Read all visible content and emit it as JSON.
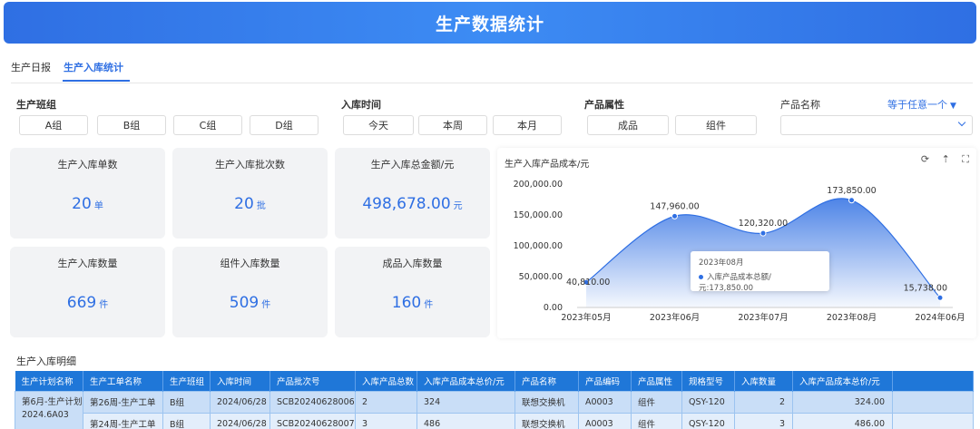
{
  "header": {
    "title": "生产数据统计"
  },
  "tabs": [
    {
      "label": "生产日报",
      "active": false
    },
    {
      "label": "生产入库统计",
      "active": true
    }
  ],
  "filters": {
    "team": {
      "label": "生产班组",
      "options": [
        "A组",
        "B组",
        "C组",
        "D组"
      ]
    },
    "time": {
      "label": "入库时间",
      "options": [
        "今天",
        "本周",
        "本月"
      ]
    },
    "attr": {
      "label": "产品属性",
      "options": [
        "成品",
        "组件"
      ]
    },
    "product_name": {
      "label": "产品名称",
      "match_mode": "等于任意一个",
      "value": ""
    }
  },
  "stats": [
    {
      "title": "生产入库单数",
      "value": "20",
      "unit": "单"
    },
    {
      "title": "生产入库批次数",
      "value": "20",
      "unit": "批"
    },
    {
      "title": "生产入库总金额/元",
      "value": "498,678.00",
      "unit": "元"
    },
    {
      "title": "生产入库数量",
      "value": "669",
      "unit": "件"
    },
    {
      "title": "组件入库数量",
      "value": "509",
      "unit": "件"
    },
    {
      "title": "成品入库数量",
      "value": "160",
      "unit": "件"
    }
  ],
  "chart_data": {
    "type": "area",
    "title": "生产入库产品成本/元",
    "categories": [
      "2023年05月",
      "2023年06月",
      "2023年07月",
      "2023年08月",
      "2024年06月"
    ],
    "series": [
      {
        "name": "入库产品成本总额/元",
        "values": [
          40810.0,
          147960.0,
          120320.0,
          173850.0,
          15738.0
        ]
      }
    ],
    "data_labels": [
      "40,810.00",
      "147,960.00",
      "120,320.00",
      "173,850.00",
      "15,738.00"
    ],
    "yticks": [
      "0.00",
      "50,000.00",
      "100,000.00",
      "150,000.00",
      "200,000.00"
    ],
    "ylim": [
      0,
      200000
    ],
    "smooth": true,
    "color": "#2f6fe3",
    "tooltip": {
      "title": "2023年08月",
      "series": "入库产品成本总额/元",
      "value": "173,850.00"
    }
  },
  "chart_tools": {
    "refresh": "⟳",
    "sort": "⇡",
    "fullscreen": "⛶"
  },
  "detail": {
    "title": "生产入库明细",
    "columns": [
      "生产计划名称",
      "生产工单名称",
      "生产班组",
      "入库时间",
      "产品批次号",
      "入库产品总数",
      "入库产品成本总价/元",
      "产品名称",
      "产品编码",
      "产品属性",
      "规格型号",
      "入库数量",
      "入库产品成本总价/元"
    ],
    "plan_name": "第6月-生产计划2024.6A03",
    "rows": [
      [
        "第26周-生产工单",
        "B组",
        "2024/06/28",
        "SCB20240628006",
        "2",
        "324",
        "联想交换机",
        "A0003",
        "组件",
        "QSY-120",
        "2",
        "324.00"
      ],
      [
        "第24周-生产工单",
        "B组",
        "2024/06/28",
        "SCB20240628007",
        "3",
        "486",
        "联想交换机",
        "A0003",
        "组件",
        "QSY-120",
        "3",
        "486.00"
      ]
    ]
  }
}
